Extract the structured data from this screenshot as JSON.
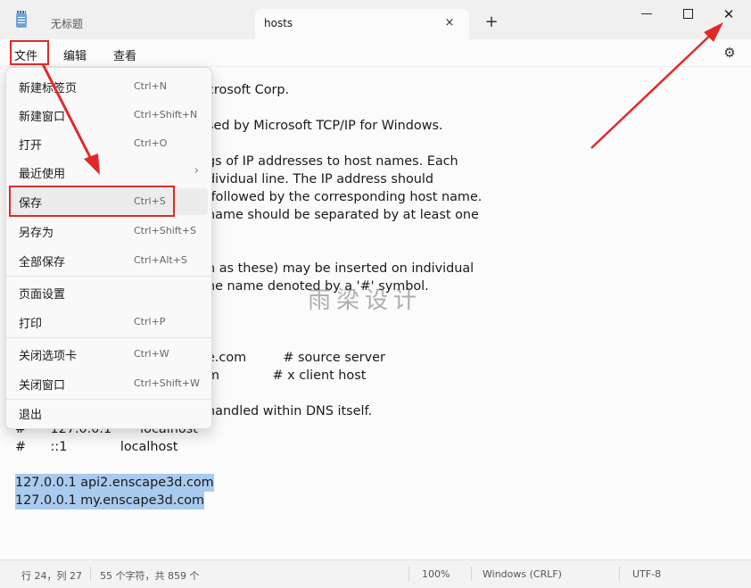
{
  "tabs": {
    "inactive_title": "无标题",
    "active_title": "hosts",
    "close_icon": "×",
    "new_tab_icon": "+"
  },
  "window": {
    "minimize": "—",
    "close": "✕"
  },
  "menubar": {
    "file": "文件",
    "edit": "编辑",
    "view": "查看",
    "settings_icon": "⚙"
  },
  "editor": {
    "lines": [
      "crosoft Corp.",
      "sed by Microsoft TCP/IP for Windows.",
      "gs of IP addresses to host names. Each",
      "dividual line. The IP address should",
      " followed by the corresponding host name.",
      "name should be separated by at least one",
      "h as these) may be inserted on individual",
      "ne name denoted by a '#' symbol.",
      "e.com         # source server",
      "m             # x client host",
      "handled within DNS itself.",
      "#      127.0.0.1       localhost",
      "#      ::1             localhost",
      "127.0.0.1 api2.enscape3d.com",
      "127.0.0.1 my.enscape3d.com"
    ]
  },
  "watermark": "雨梁设计",
  "file_menu": {
    "items": [
      {
        "label": "新建标签页",
        "shortcut": "Ctrl+N"
      },
      {
        "label": "新建窗口",
        "shortcut": "Ctrl+Shift+N"
      },
      {
        "label": "打开",
        "shortcut": "Ctrl+O"
      },
      {
        "label": "最近使用",
        "shortcut": "",
        "arrow": "›"
      },
      {
        "label": "保存",
        "shortcut": "Ctrl+S"
      },
      {
        "label": "另存为",
        "shortcut": "Ctrl+Shift+S"
      },
      {
        "label": "全部保存",
        "shortcut": "Ctrl+Alt+S"
      },
      {
        "label": "页面设置",
        "shortcut": ""
      },
      {
        "label": "打印",
        "shortcut": "Ctrl+P"
      },
      {
        "label": "关闭选项卡",
        "shortcut": "Ctrl+W"
      },
      {
        "label": "关闭窗口",
        "shortcut": "Ctrl+Shift+W"
      },
      {
        "label": "退出",
        "shortcut": ""
      }
    ]
  },
  "status": {
    "position": "行 24，列 27",
    "chars": "55 个字符，共 859 个",
    "zoom": "100%",
    "line_ending": "Windows (CRLF)",
    "encoding": "UTF-8"
  },
  "colors": {
    "annotation": "#e02a2a",
    "selection": "#a9cbee"
  }
}
